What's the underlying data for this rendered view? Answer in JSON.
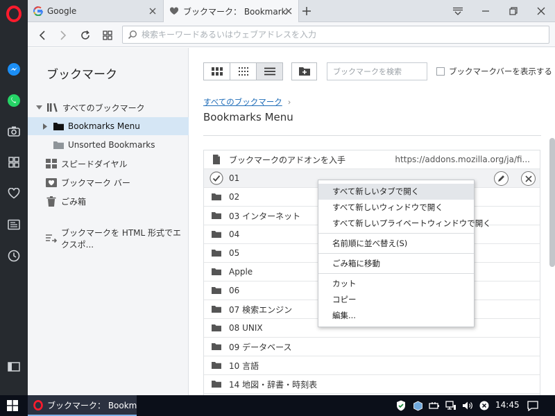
{
  "tabs": [
    {
      "title": "Google"
    },
    {
      "title": "ブックマーク： Bookmarks Menu"
    }
  ],
  "address": {
    "placeholder": "検索キーワードあるいはウェブアドレスを入力"
  },
  "sidebar": {
    "title": "ブックマーク",
    "items": [
      {
        "label": "すべてのブックマーク"
      },
      {
        "label": "Bookmarks Menu"
      },
      {
        "label": "Unsorted Bookmarks"
      },
      {
        "label": "スピードダイヤル"
      },
      {
        "label": "ブックマーク バー"
      },
      {
        "label": "ごみ箱"
      },
      {
        "label": "ブックマークを HTML 形式でエクスポ..."
      }
    ]
  },
  "toolbar": {
    "search_placeholder": "ブックマークを検索",
    "show_bar_label": "ブックマークバーを表示する"
  },
  "breadcrumb": {
    "root": "すべてのブックマーク",
    "sep": "›"
  },
  "folder_title": "Bookmarks Menu",
  "rows": [
    {
      "name": "ブックマークのアドオンを入手",
      "url": "https://addons.mozilla.org/ja/fi..."
    },
    {
      "name": "01"
    },
    {
      "name": "02"
    },
    {
      "name": "03 インターネット"
    },
    {
      "name": "04"
    },
    {
      "name": "05"
    },
    {
      "name": "Apple"
    },
    {
      "name": "06"
    },
    {
      "name": "07 検索エンジン"
    },
    {
      "name": "08 UNIX"
    },
    {
      "name": "09 データベース"
    },
    {
      "name": "10 言語"
    },
    {
      "name": "14 地図・辞書・時刻表"
    }
  ],
  "context_menu": [
    "すべて新しいタブで開く",
    "すべて新しいウィンドウで開く",
    "すべて新しいプライベートウィンドウで開く",
    "名前順に並べ替え(S)",
    "ごみ箱に移動",
    "カット",
    "コピー",
    "編集..."
  ],
  "taskbar": {
    "app_label": "ブックマーク： Bookmar...",
    "time": "14:45"
  },
  "colors": {
    "opera_red": "#ff1b2d",
    "link_blue": "#1e6cb8",
    "selected_bg": "#d5e6f5",
    "taskbar_bg": "#0b0f19"
  }
}
